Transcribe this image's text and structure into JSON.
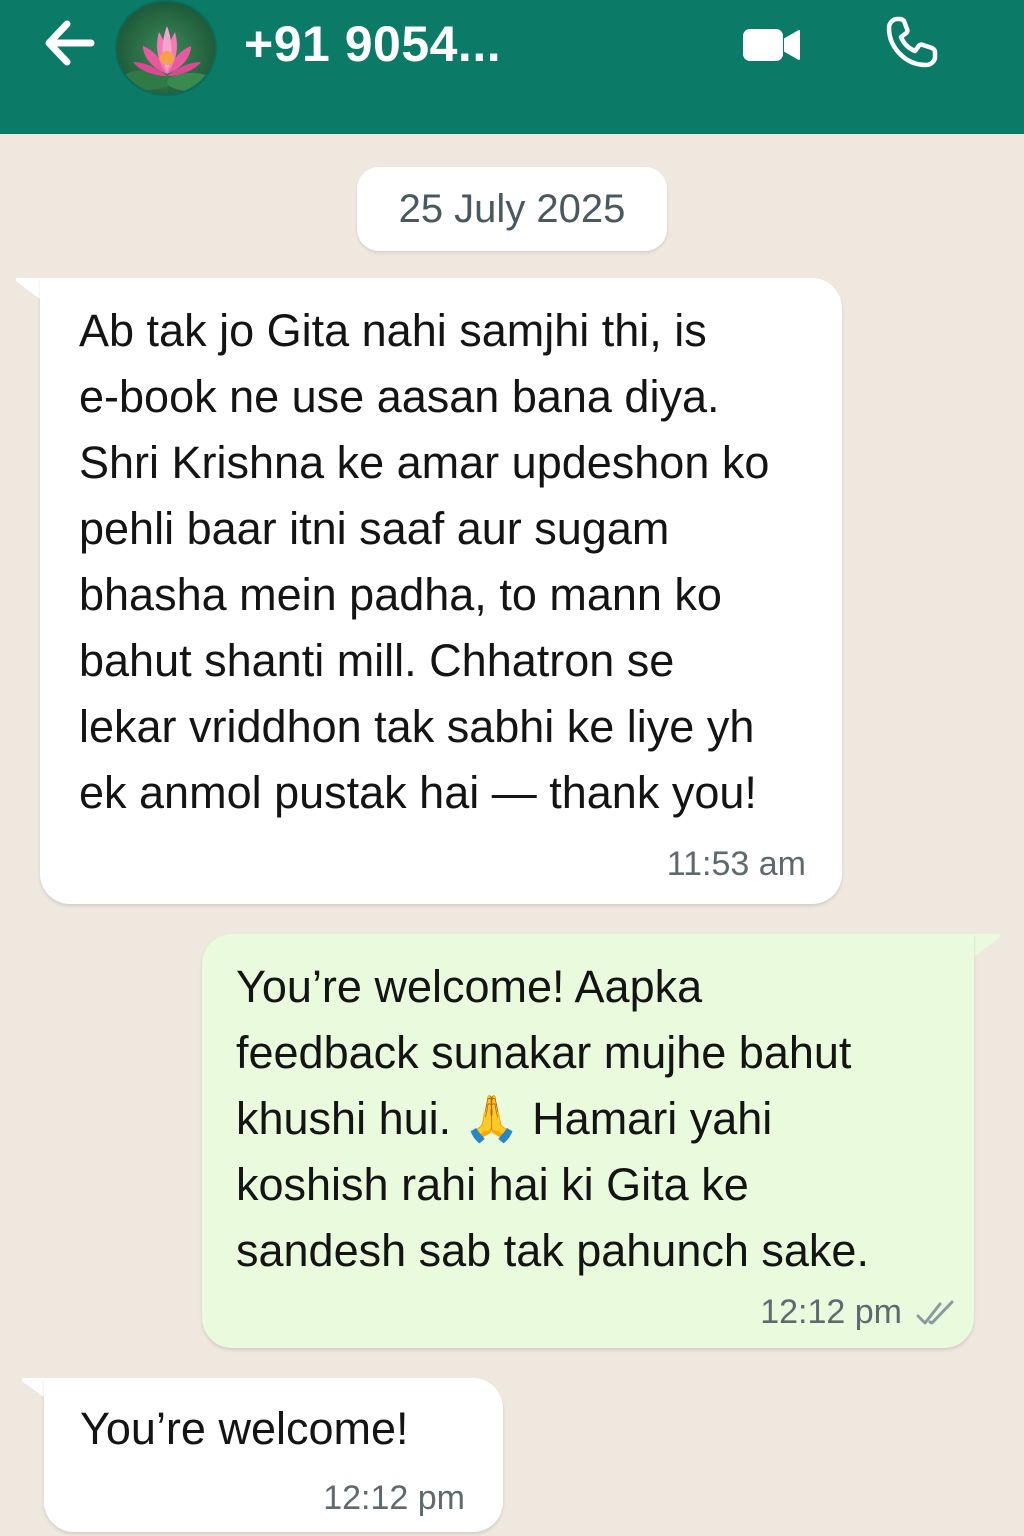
{
  "header": {
    "contact_name": "+91 9054...",
    "back_icon": "arrow-left-icon",
    "video_icon": "video-camera-icon",
    "call_icon": "phone-icon",
    "background_color": "#0b7a66"
  },
  "chat": {
    "date_label": "25 July 2025",
    "messages": [
      {
        "direction": "incoming",
        "lines": [
          "Ab tak jo Gita nahi samjhi thi, is",
          "e-book ne use aasan bana diya.",
          "Shri Krishna ke amar updeshon ko",
          "pehli baar itni saaf aur sugam",
          "bhasha mein padha, to mann ko",
          "bahut shanti mill. Chhatron se",
          "lekar vriddhon tak sabhi ke liye yh",
          "ek anmol pustak hai — thank you!"
        ],
        "time": "11:53 am"
      },
      {
        "direction": "outgoing",
        "lines": [
          "You’re welcome! Aapka",
          "feedback sunakar mujhe bahut",
          "khushi hui. 🙏 Hamari yahi",
          "koshish rahi hai ki Gita ke",
          "sandesh sab tak pahunch sake."
        ],
        "time": "12:12 pm",
        "status_icon": "double-check-icon"
      },
      {
        "direction": "incoming",
        "lines": [
          "You’re welcome!"
        ],
        "time": "12:12 pm"
      }
    ]
  },
  "colors": {
    "chat_background": "#efe8df",
    "incoming_bubble": "#ffffff",
    "outgoing_bubble": "#e9fbdc"
  }
}
